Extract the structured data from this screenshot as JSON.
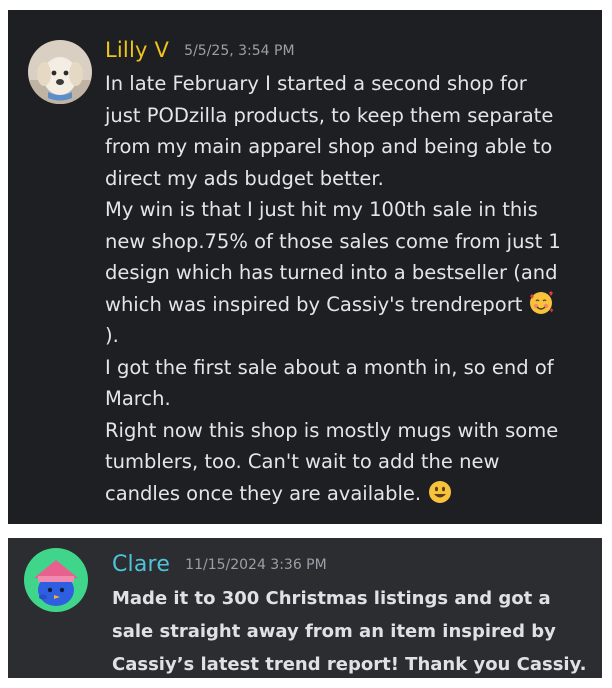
{
  "messages": [
    {
      "author": "Lilly V",
      "timestamp": "5/5/25, 3:54 PM",
      "avatar": "puppy-avatar-icon",
      "author_color": "#f0c419",
      "lines": [
        "In late February I started a second shop for",
        "just PODzilla products, to keep them separate",
        "from my main apparel shop and being able to",
        "direct my ads budget better.",
        "My win is that I just hit my 100th sale in this",
        "new shop.75% of those sales come from just 1",
        "design which has turned into a bestseller (and",
        "which was inspired by Cassiy's trendreport",
        ").",
        "I got the first sale about a month in, so end of",
        "March.",
        "Right now this shop is mostly mugs with some",
        "tumblers, too. Can't wait to add the new",
        "candles once they are available."
      ],
      "emojis": [
        "smiling-face-with-hearts-icon",
        "grinning-face-icon"
      ]
    },
    {
      "author": "Clare",
      "timestamp": "11/15/2024 3:36 PM",
      "avatar": "blue-character-avatar-icon",
      "author_color": "#4fc3d9",
      "lines": [
        "Made it to 300 Christmas listings and got a",
        "sale straight away from an item inspired by",
        "Cassiy’s latest trend report! Thank you Cassiy."
      ]
    }
  ]
}
